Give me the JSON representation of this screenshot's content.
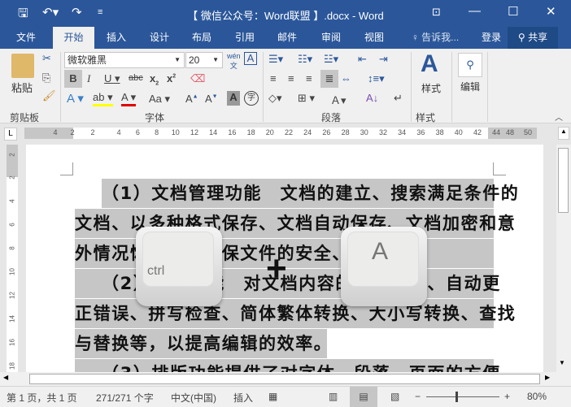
{
  "title": "【 微信公众号：Word联盟 】.docx - Word",
  "tabs": [
    "文件",
    "开始",
    "插入",
    "设计",
    "布局",
    "引用",
    "邮件",
    "审阅",
    "视图"
  ],
  "tell_me": "告诉我...",
  "login": "登录",
  "share": "共享",
  "ribbon": {
    "paste": "粘贴",
    "font_name": "微软雅黑",
    "font_size": "20",
    "styles": "样式",
    "edit": "编辑",
    "groups": {
      "clipboard": "剪贴板",
      "font": "字体",
      "paragraph": "段落",
      "styles": "样式"
    }
  },
  "ruler": {
    "left": [
      "4",
      "2"
    ],
    "main": [
      "2",
      "4",
      "6",
      "8",
      "10",
      "12",
      "14",
      "16",
      "18",
      "20",
      "22",
      "24",
      "26",
      "28",
      "30",
      "32",
      "34",
      "36",
      "38",
      "40",
      "42",
      "44"
    ],
    "right": [
      "48",
      "50"
    ],
    "vertical": [
      "2",
      "2",
      "4",
      "6",
      "8",
      "10",
      "12",
      "14",
      "16",
      "18"
    ]
  },
  "document": {
    "lines": [
      "（1）文档管理功能　文档的建立、搜索满足条件的",
      "文档、以多种格式保存、文档自动保存、文档加密和意",
      "外情况恢复，以确保文件的安全、",
      "（2）编辑功能　对文档内容的多种编辑、自动更",
      "正错误、拼写检查、简体繁体转换、大小写转换、查找",
      "与替换等，以提高编辑的效率。",
      "（3）排版功能提供了对字体、段落、页面的方便"
    ]
  },
  "keys": {
    "ctrl": "ctrl",
    "a": "A",
    "plus": "+"
  },
  "status": {
    "page": "第 1 页，共 1 页",
    "words": "271/271 个字",
    "lang": "中文(中国)",
    "mode": "插入",
    "zoom": "80%"
  },
  "colors": {
    "brand": "#2b579a",
    "highlight": "#c6c6c6"
  }
}
